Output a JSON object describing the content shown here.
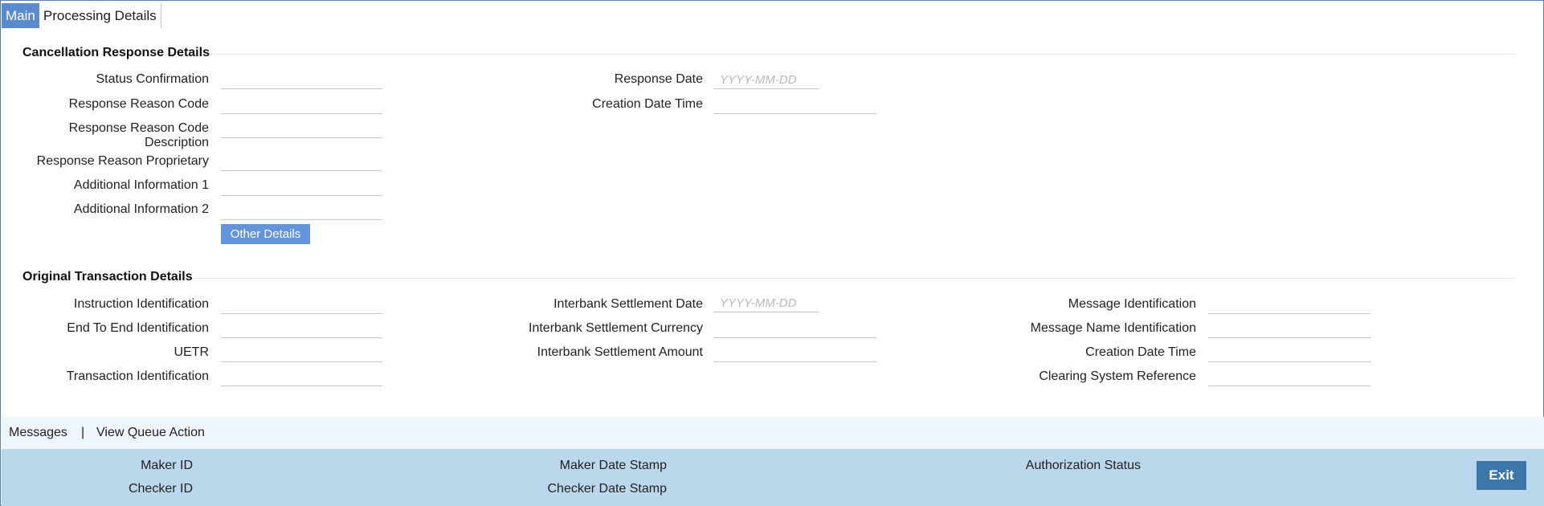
{
  "tabs": {
    "main": "Main",
    "processing": "Processing Details"
  },
  "cancellation": {
    "title": "Cancellation Response Details",
    "status_confirmation": {
      "label": "Status Confirmation",
      "value": ""
    },
    "response_reason_code": {
      "label": "Response Reason Code",
      "value": ""
    },
    "response_reason_code_desc": {
      "label_line1": "Response Reason Code",
      "label_line2": "Description",
      "value": ""
    },
    "response_reason_proprietary": {
      "label": "Response Reason Proprietary",
      "value": ""
    },
    "additional_info_1": {
      "label": "Additional Information 1",
      "value": ""
    },
    "additional_info_2": {
      "label": "Additional Information 2",
      "value": ""
    },
    "response_date": {
      "label": "Response Date",
      "value": "",
      "placeholder": "YYYY-MM-DD"
    },
    "creation_date_time": {
      "label": "Creation Date Time",
      "value": ""
    },
    "other_details_button": "Other Details"
  },
  "original": {
    "title": "Original Transaction Details",
    "instruction_id": {
      "label": "Instruction Identification",
      "value": ""
    },
    "end_to_end_id": {
      "label": "End To End Identification",
      "value": ""
    },
    "uetr": {
      "label": "UETR",
      "value": ""
    },
    "transaction_id": {
      "label": "Transaction Identification",
      "value": ""
    },
    "interbank_settlement_date": {
      "label": "Interbank Settlement Date",
      "value": "",
      "placeholder": "YYYY-MM-DD"
    },
    "interbank_settlement_currency": {
      "label": "Interbank Settlement Currency",
      "value": ""
    },
    "interbank_settlement_amount": {
      "label": "Interbank Settlement Amount",
      "value": ""
    },
    "message_id": {
      "label": "Message Identification",
      "value": ""
    },
    "message_name_id": {
      "label": "Message Name Identification",
      "value": ""
    },
    "creation_date_time": {
      "label": "Creation Date Time",
      "value": ""
    },
    "clearing_system_reference": {
      "label": "Clearing System Reference",
      "value": ""
    }
  },
  "message_bar": {
    "messages": "Messages",
    "separator": "|",
    "view_queue_action": "View Queue Action"
  },
  "footer": {
    "maker_id": "Maker ID",
    "checker_id": "Checker ID",
    "maker_date_stamp": "Maker Date Stamp",
    "checker_date_stamp": "Checker Date Stamp",
    "authorization_status": "Authorization Status",
    "exit_button": "Exit"
  },
  "colors": {
    "active_tab": "#5b8bcf",
    "button": "#6495dc",
    "footer_bg": "#bad7ec",
    "message_bar_bg": "#eef5fc",
    "exit_button": "#3d77aa"
  }
}
